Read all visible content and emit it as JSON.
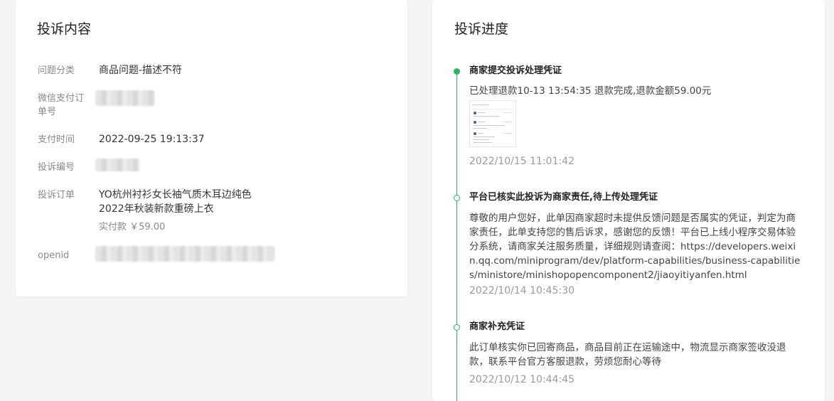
{
  "complaint_content": {
    "title": "投诉内容",
    "fields": {
      "issue_category": {
        "label": "问题分类",
        "value": "商品问题-描述不符"
      },
      "wechat_order_no": {
        "label": "微信支付订单号"
      },
      "payment_time": {
        "label": "支付时间",
        "value": "2022-09-25 19:13:37"
      },
      "complaint_no": {
        "label": "投诉编号"
      },
      "complaint_order": {
        "label": "投诉订单",
        "product_line1": "YO杭州衬衫女长袖气质木耳边纯色",
        "product_line2": "2022年秋装新款重磅上衣",
        "price_label": "实付款",
        "price": "￥59.00"
      },
      "openid": {
        "label": "openid"
      }
    }
  },
  "complaint_progress": {
    "title": "投诉进度",
    "events": [
      {
        "heading": "商家提交投诉处理凭证",
        "description": "已处理退款10-13 13:54:35 退款完成,退款金额59.00元",
        "time": "2022/10/15 11:01:42",
        "active": true
      },
      {
        "heading": "平台已核实此投诉为商家责任,待上传处理凭证",
        "description": "尊敬的用户您好，此单因商家超时未提供反馈问题是否属实的凭证，判定为商家责任，此单支持您的售后诉求，感谢您的反馈！平台已上线小程序交易体验分系统，请商家关注服务质量，详细规则请查阅：https://developers.weixin.qq.com/miniprogram/dev/platform-capabilities/business-capabilities/ministore/minishopopencomponent2/jiaoyitiyanfen.html",
        "time": "2022/10/14 10:45:30",
        "active": false
      },
      {
        "heading": "商家补充凭证",
        "description": "此订单核实你已回寄商品，商品目前正在运输途中，物流显示商家签收没退款，联系平台官方客服退款，劳烦您耐心等待",
        "time": "2022/10/12 10:44:45",
        "active": false
      }
    ]
  },
  "colors": {
    "accent_green": "#2eb45f",
    "label_gray": "#8a8a8a",
    "page_background": "#f4f5f7"
  }
}
